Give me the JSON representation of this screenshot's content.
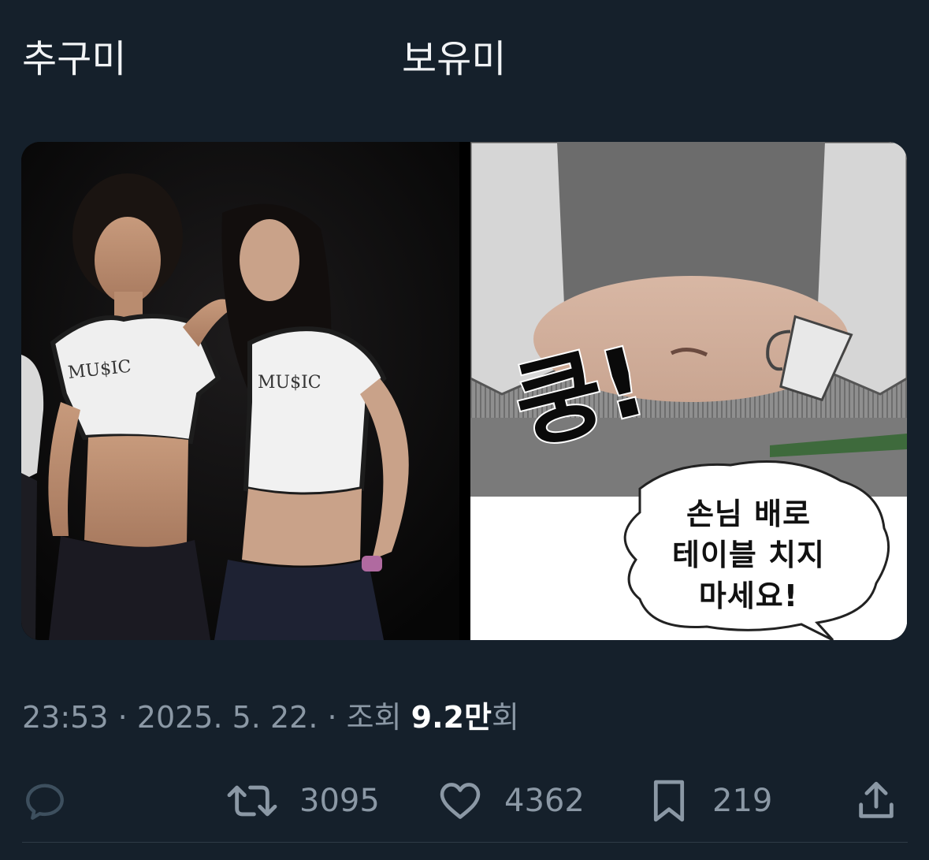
{
  "tweet": {
    "text_left": "추구미",
    "text_right": "보유미"
  },
  "media": {
    "left_description": "two-women-photo",
    "left_shirt_text": "MU$IC",
    "right_sfx": "쿵!",
    "right_speech": "손님 배로 테이블 치지 마세요!",
    "right_speech_lines": [
      "손님 배로",
      "테이블 치지",
      "마세요!"
    ]
  },
  "meta": {
    "time": "23:53",
    "separator": " · ",
    "date": "2025. 5. 22.",
    "views_label": "조회 ",
    "views_number": "9.2",
    "views_unit": "만",
    "views_suffix": "회"
  },
  "actions": {
    "reply": {
      "icon": "reply-icon",
      "count": ""
    },
    "retweet": {
      "icon": "retweet-icon",
      "count": "3095"
    },
    "like": {
      "icon": "heart-icon",
      "count": "4362"
    },
    "bookmark": {
      "icon": "bookmark-icon",
      "count": "219"
    },
    "share": {
      "icon": "share-icon"
    }
  },
  "colors": {
    "background": "#15202b",
    "text": "#ffffff",
    "muted": "#8b98a5"
  }
}
